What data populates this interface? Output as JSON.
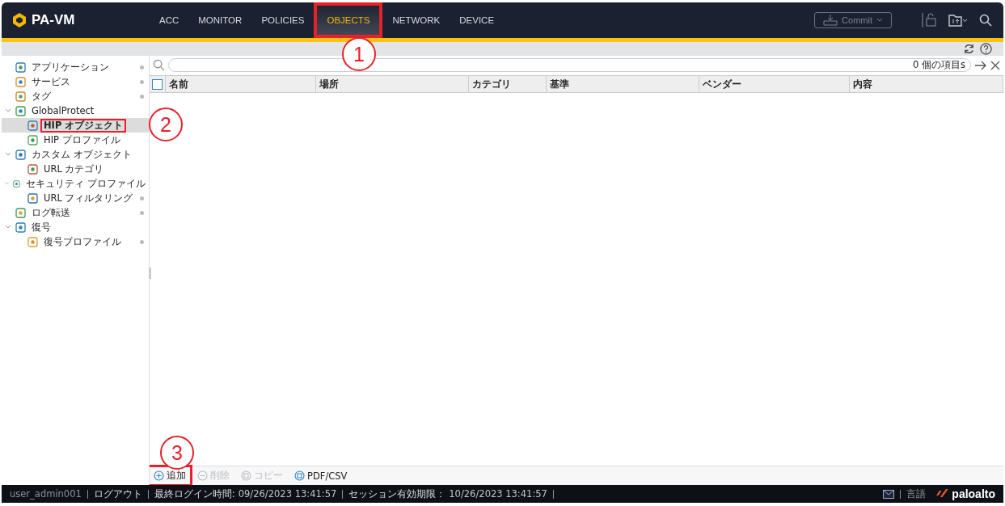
{
  "header": {
    "product": "PA-VM",
    "tabs": [
      {
        "label": "ACC",
        "selected": false,
        "highlighted": false
      },
      {
        "label": "MONITOR",
        "selected": false,
        "highlighted": false
      },
      {
        "label": "POLICIES",
        "selected": false,
        "highlighted": false
      },
      {
        "label": "OBJECTS",
        "selected": true,
        "highlighted": true
      },
      {
        "label": "NETWORK",
        "selected": false,
        "highlighted": false
      },
      {
        "label": "DEVICE",
        "selected": false,
        "highlighted": false
      }
    ],
    "commit": {
      "label": "Commit",
      "disabled": true
    }
  },
  "sidebar": {
    "items": [
      {
        "label": "アプリケーション",
        "selected": false,
        "highlighted": false,
        "marked": true
      },
      {
        "label": "サービス",
        "selected": false,
        "highlighted": false,
        "marked": true
      },
      {
        "label": "タグ",
        "selected": false,
        "highlighted": false,
        "marked": true
      },
      {
        "label": "GlobalProtect",
        "selected": false,
        "highlighted": false,
        "marked": false,
        "expanded": true,
        "children": [
          {
            "label": "HIP オブジェクト",
            "selected": true,
            "highlighted": true,
            "marked": false
          },
          {
            "label": "HIP プロファイル",
            "selected": false,
            "highlighted": false,
            "marked": false
          }
        ]
      },
      {
        "label": "カスタム オブジェクト",
        "selected": false,
        "highlighted": false,
        "marked": false,
        "expanded": true,
        "children": [
          {
            "label": "URL カテゴリ",
            "selected": false,
            "highlighted": false,
            "marked": false
          }
        ]
      },
      {
        "label": "セキュリティ プロファイル",
        "selected": false,
        "highlighted": false,
        "marked": false,
        "expanded": true,
        "children": [
          {
            "label": "URL フィルタリング",
            "selected": false,
            "highlighted": false,
            "marked": true
          }
        ]
      },
      {
        "label": "ログ転送",
        "selected": false,
        "highlighted": false,
        "marked": true
      },
      {
        "label": "復号",
        "selected": false,
        "highlighted": false,
        "marked": false,
        "expanded": true,
        "children": [
          {
            "label": "復号プロファイル",
            "selected": false,
            "highlighted": false,
            "marked": true
          }
        ]
      }
    ]
  },
  "search": {
    "count": "0 個の項目s"
  },
  "table": {
    "columns": [
      "名前",
      "場所",
      "カテゴリ",
      "基準",
      "ベンダー",
      "内容"
    ],
    "select_all": false
  },
  "toolbar": [
    {
      "label": "追加",
      "disabled": false,
      "highlighted": true
    },
    {
      "label": "削除",
      "disabled": true,
      "highlighted": false
    },
    {
      "label": "コピー",
      "disabled": true,
      "highlighted": false
    },
    {
      "label": "PDF/CSV",
      "disabled": false,
      "highlighted": false
    }
  ],
  "status_bar": {
    "user": "user_admin001",
    "logout": "ログアウト",
    "last_login_label": "最終ログイン時間:",
    "last_login": "09/26/2023 13:41:57",
    "session_label": "セッション有効期限：",
    "session_expiry": "10/26/2023 13:41:57",
    "language": "言語",
    "brand": "paloalto"
  },
  "annotations": [
    {
      "number": "1"
    },
    {
      "number": "2"
    },
    {
      "number": "3"
    }
  ]
}
